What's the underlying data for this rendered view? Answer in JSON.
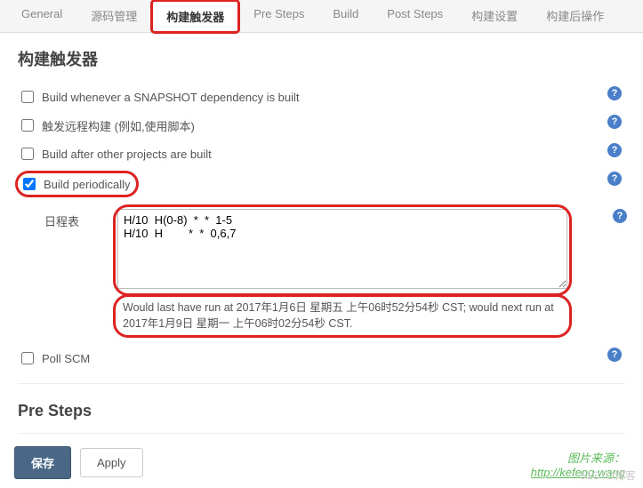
{
  "tabs": [
    {
      "label": "General",
      "active": false
    },
    {
      "label": "源码管理",
      "active": false
    },
    {
      "label": "构建触发器",
      "active": true
    },
    {
      "label": "Pre Steps",
      "active": false
    },
    {
      "label": "Build",
      "active": false
    },
    {
      "label": "Post Steps",
      "active": false
    },
    {
      "label": "构建设置",
      "active": false
    },
    {
      "label": "构建后操作",
      "active": false
    }
  ],
  "triggers": {
    "heading": "构建触发器",
    "opt_snapshot": "Build whenever a SNAPSHOT dependency is built",
    "opt_remote": "触发远程构建 (例如,使用脚本)",
    "opt_after": "Build after other projects are built",
    "opt_periodic": "Build periodically",
    "opt_pollscm": "Poll SCM",
    "schedule_label": "日程表",
    "schedule_value": "H/10  H(0-8)  *  *  1-5\nH/10  H        *  *  0,6,7",
    "schedule_info": "Would last have run at 2017年1月6日 星期五 上午06时52分54秒 CST; would next run at 2017年1月9日 星期一 上午06时02分54秒 CST."
  },
  "presteps": {
    "heading": "Pre Steps"
  },
  "buttons": {
    "save": "保存",
    "apply": "Apply"
  },
  "watermark": {
    "line1": "图片来源：",
    "url": "http://kefeng.wang",
    "faded": "51CTO博客"
  }
}
